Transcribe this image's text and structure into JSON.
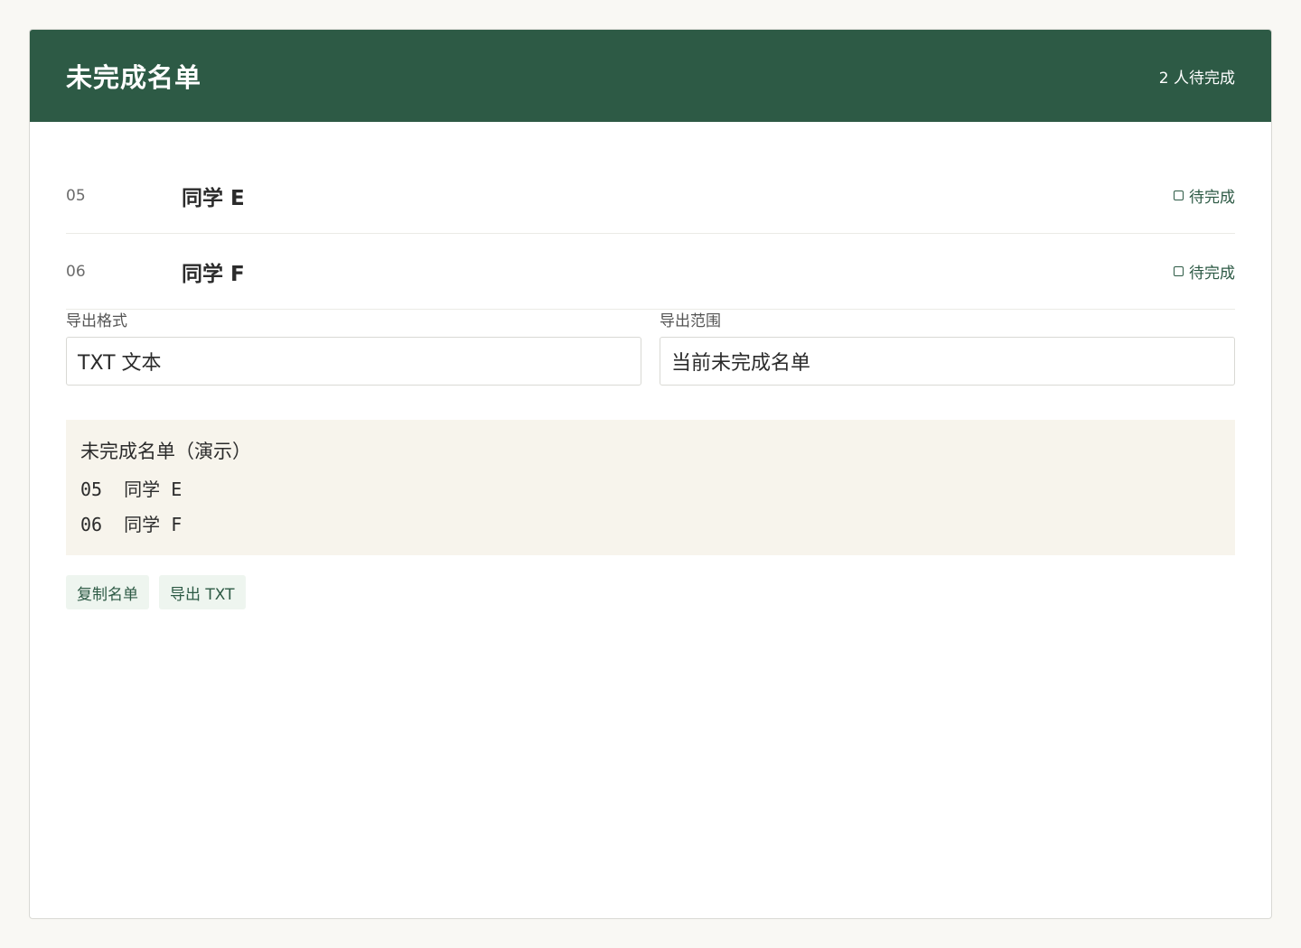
{
  "header": {
    "title": "未完成名单",
    "count_label": "2 人待完成"
  },
  "rows": [
    {
      "number": "05",
      "name": "同学 E",
      "status": "待完成"
    },
    {
      "number": "06",
      "name": "同学 F",
      "status": "待完成"
    }
  ],
  "export": {
    "format_label": "导出格式",
    "format_value": "TXT 文本",
    "range_label": "导出范围",
    "range_value": "当前未完成名单"
  },
  "preview": {
    "title": "未完成名单（演示）",
    "lines": [
      "05  同学 E",
      "06  同学 F"
    ]
  },
  "actions": {
    "copy_label": "复制名单",
    "export_label": "导出 TXT"
  },
  "colors": {
    "header_bg": "#2d5a45",
    "preview_bg": "#f7f4ec",
    "button_bg": "#eef5ef"
  }
}
